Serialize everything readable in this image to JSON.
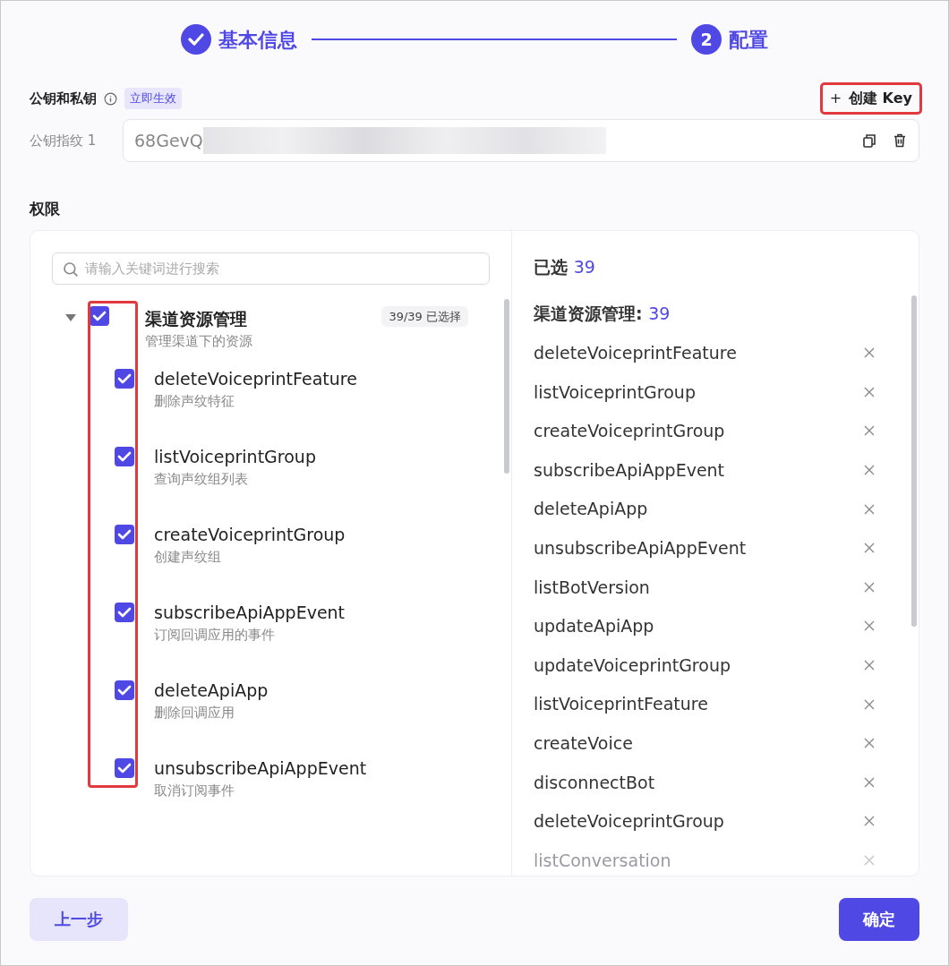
{
  "steps": [
    {
      "label": "基本信息",
      "done": true
    },
    {
      "number": "2",
      "label": "配置",
      "done": false
    }
  ],
  "keys": {
    "title": "公钥和私钥",
    "tag": "立即生效",
    "create_button": {
      "icon": "+",
      "label": "创建 Key",
      "highlighted": true
    },
    "fingerprints": [
      {
        "label": "公钥指纹 1",
        "value": "68GevQ",
        "masked": true
      }
    ]
  },
  "permissions": {
    "title": "权限",
    "search": {
      "placeholder": "请输入关键词进行搜索"
    },
    "checkboxes_highlighted": true,
    "tree": [
      {
        "label": "渠道资源管理",
        "description": "管理渠道下的资源",
        "count": "39/39 已选择",
        "checked": true,
        "expanded": true,
        "children": [
          {
            "label": "deleteVoiceprintFeature",
            "description": "删除声纹特征",
            "checked": true
          },
          {
            "label": "listVoiceprintGroup",
            "description": "查询声纹组列表",
            "checked": true
          },
          {
            "label": "createVoiceprintGroup",
            "description": "创建声纹组",
            "checked": true
          },
          {
            "label": "subscribeApiAppEvent",
            "description": "订阅回调应用的事件",
            "checked": true
          },
          {
            "label": "deleteApiApp",
            "description": "删除回调应用",
            "checked": true
          },
          {
            "label": "unsubscribeApiAppEvent",
            "description": "取消订阅事件",
            "checked": true
          }
        ]
      }
    ],
    "selected": {
      "title": "已选",
      "count": "39",
      "groups": [
        {
          "title": "渠道资源管理:",
          "count": "39",
          "items": [
            {
              "label": "deleteVoiceprintFeature",
              "faded": false
            },
            {
              "label": "listVoiceprintGroup",
              "faded": false
            },
            {
              "label": "createVoiceprintGroup",
              "faded": false
            },
            {
              "label": "subscribeApiAppEvent",
              "faded": false
            },
            {
              "label": "deleteApiApp",
              "faded": false
            },
            {
              "label": "unsubscribeApiAppEvent",
              "faded": false
            },
            {
              "label": "listBotVersion",
              "faded": false
            },
            {
              "label": "updateApiApp",
              "faded": false
            },
            {
              "label": "updateVoiceprintGroup",
              "faded": false
            },
            {
              "label": "listVoiceprintFeature",
              "faded": false
            },
            {
              "label": "createVoice",
              "faded": false
            },
            {
              "label": "disconnectBot",
              "faded": false
            },
            {
              "label": "deleteVoiceprintGroup",
              "faded": false
            },
            {
              "label": "listConversation",
              "faded": true
            }
          ]
        }
      ]
    }
  },
  "footer": {
    "back": "上一步",
    "confirm": "确定"
  }
}
